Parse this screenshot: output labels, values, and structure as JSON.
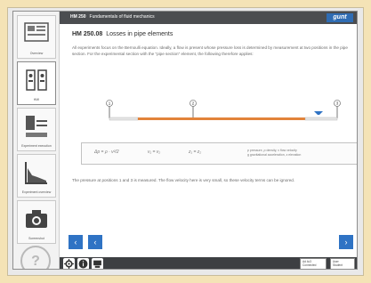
{
  "app": {
    "title_code": "HM 250",
    "title_text": "Fundamentals of fluid mechanics",
    "logo": "gunt"
  },
  "sidebar": {
    "items": [
      {
        "label": "Overview",
        "icon": "overview-icon"
      },
      {
        "label": "HMI",
        "icon": "hmi-icon"
      },
      {
        "label": "Experiment execution",
        "icon": "experiment-execution-icon"
      },
      {
        "label": "Experiment overview",
        "icon": "experiment-overview-icon"
      },
      {
        "label": "Screenshot",
        "icon": "camera-icon"
      },
      {
        "label": "Help",
        "icon": "help-icon"
      }
    ],
    "help_glyph": "?"
  },
  "content": {
    "exp_code": "HM 250.08",
    "exp_name": "Losses in pipe elements",
    "paragraph1": "All experiments focus on the Bernoulli equation. Ideally, a flow is present whose pressure loss is determined by measurement at two positions in the pipe section. For the experimental section with the \"pipe section\" element, the following therefore applies:",
    "points": [
      "1",
      "2",
      "3"
    ],
    "formula": {
      "eq1": "Δp = ρ · v²/2",
      "eq2": "v₁ = v₂",
      "eq3": "z₁ = z₂",
      "legend": [
        "p pressure, ρ density, v flow velocity",
        "g gravitational acceleration, z elevation"
      ]
    },
    "paragraph2": "The pressure at positions 1 and 3 is measured. The flow velocity here is very small, so these velocity terms can be ignored."
  },
  "nav": {
    "prev": "‹",
    "back": "‹",
    "next": "›"
  },
  "bottom": {
    "status_lines": [
      "Ad 4c3",
      "Connected"
    ],
    "user_lines": [
      "User",
      "Student"
    ]
  },
  "colors": {
    "accent": "#2f73c4",
    "topbar": "#4b4d50",
    "pipe": "#e2833a"
  }
}
